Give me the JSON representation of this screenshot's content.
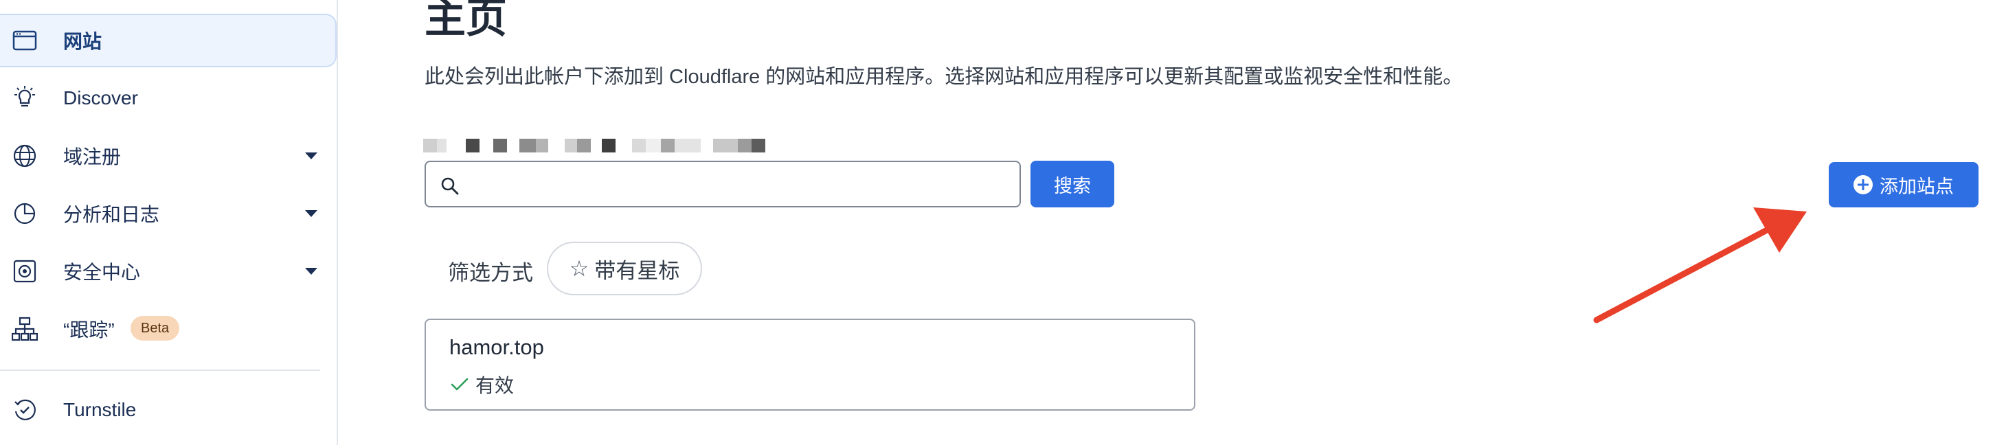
{
  "sidebar": {
    "items": [
      {
        "label": "网站",
        "icon": "browser-window-icon",
        "active": true
      },
      {
        "label": "Discover",
        "icon": "lightbulb-icon"
      },
      {
        "label": "域注册",
        "icon": "globe-icon",
        "expandable": true
      },
      {
        "label": "分析和日志",
        "icon": "pie-chart-icon",
        "expandable": true
      },
      {
        "label": "安全中心",
        "icon": "shield-vault-icon",
        "expandable": true
      },
      {
        "label": "“跟踪”",
        "icon": "sitemap-icon",
        "badge": "Beta"
      },
      {
        "label": "Turnstile",
        "icon": "turnstile-icon"
      }
    ]
  },
  "main": {
    "title": "主页",
    "description": "此处会列出此帐户下添加到 Cloudflare 的网站和应用程序。选择网站和应用程序可以更新其配置或监视安全性和性能。",
    "search": {
      "placeholder": "",
      "value": "",
      "button_label": "搜索"
    },
    "add_site_label": "添加站点",
    "filter": {
      "label": "筛选方式",
      "chip_label": "带有星标"
    },
    "sites": [
      {
        "name": "hamor.top",
        "status": "有效"
      }
    ]
  },
  "colors": {
    "accent": "#2f6fe4",
    "annotation_arrow": "#e8402a",
    "active_nav_bg": "#eef4fd",
    "status_ok": "#2e9e5b"
  }
}
